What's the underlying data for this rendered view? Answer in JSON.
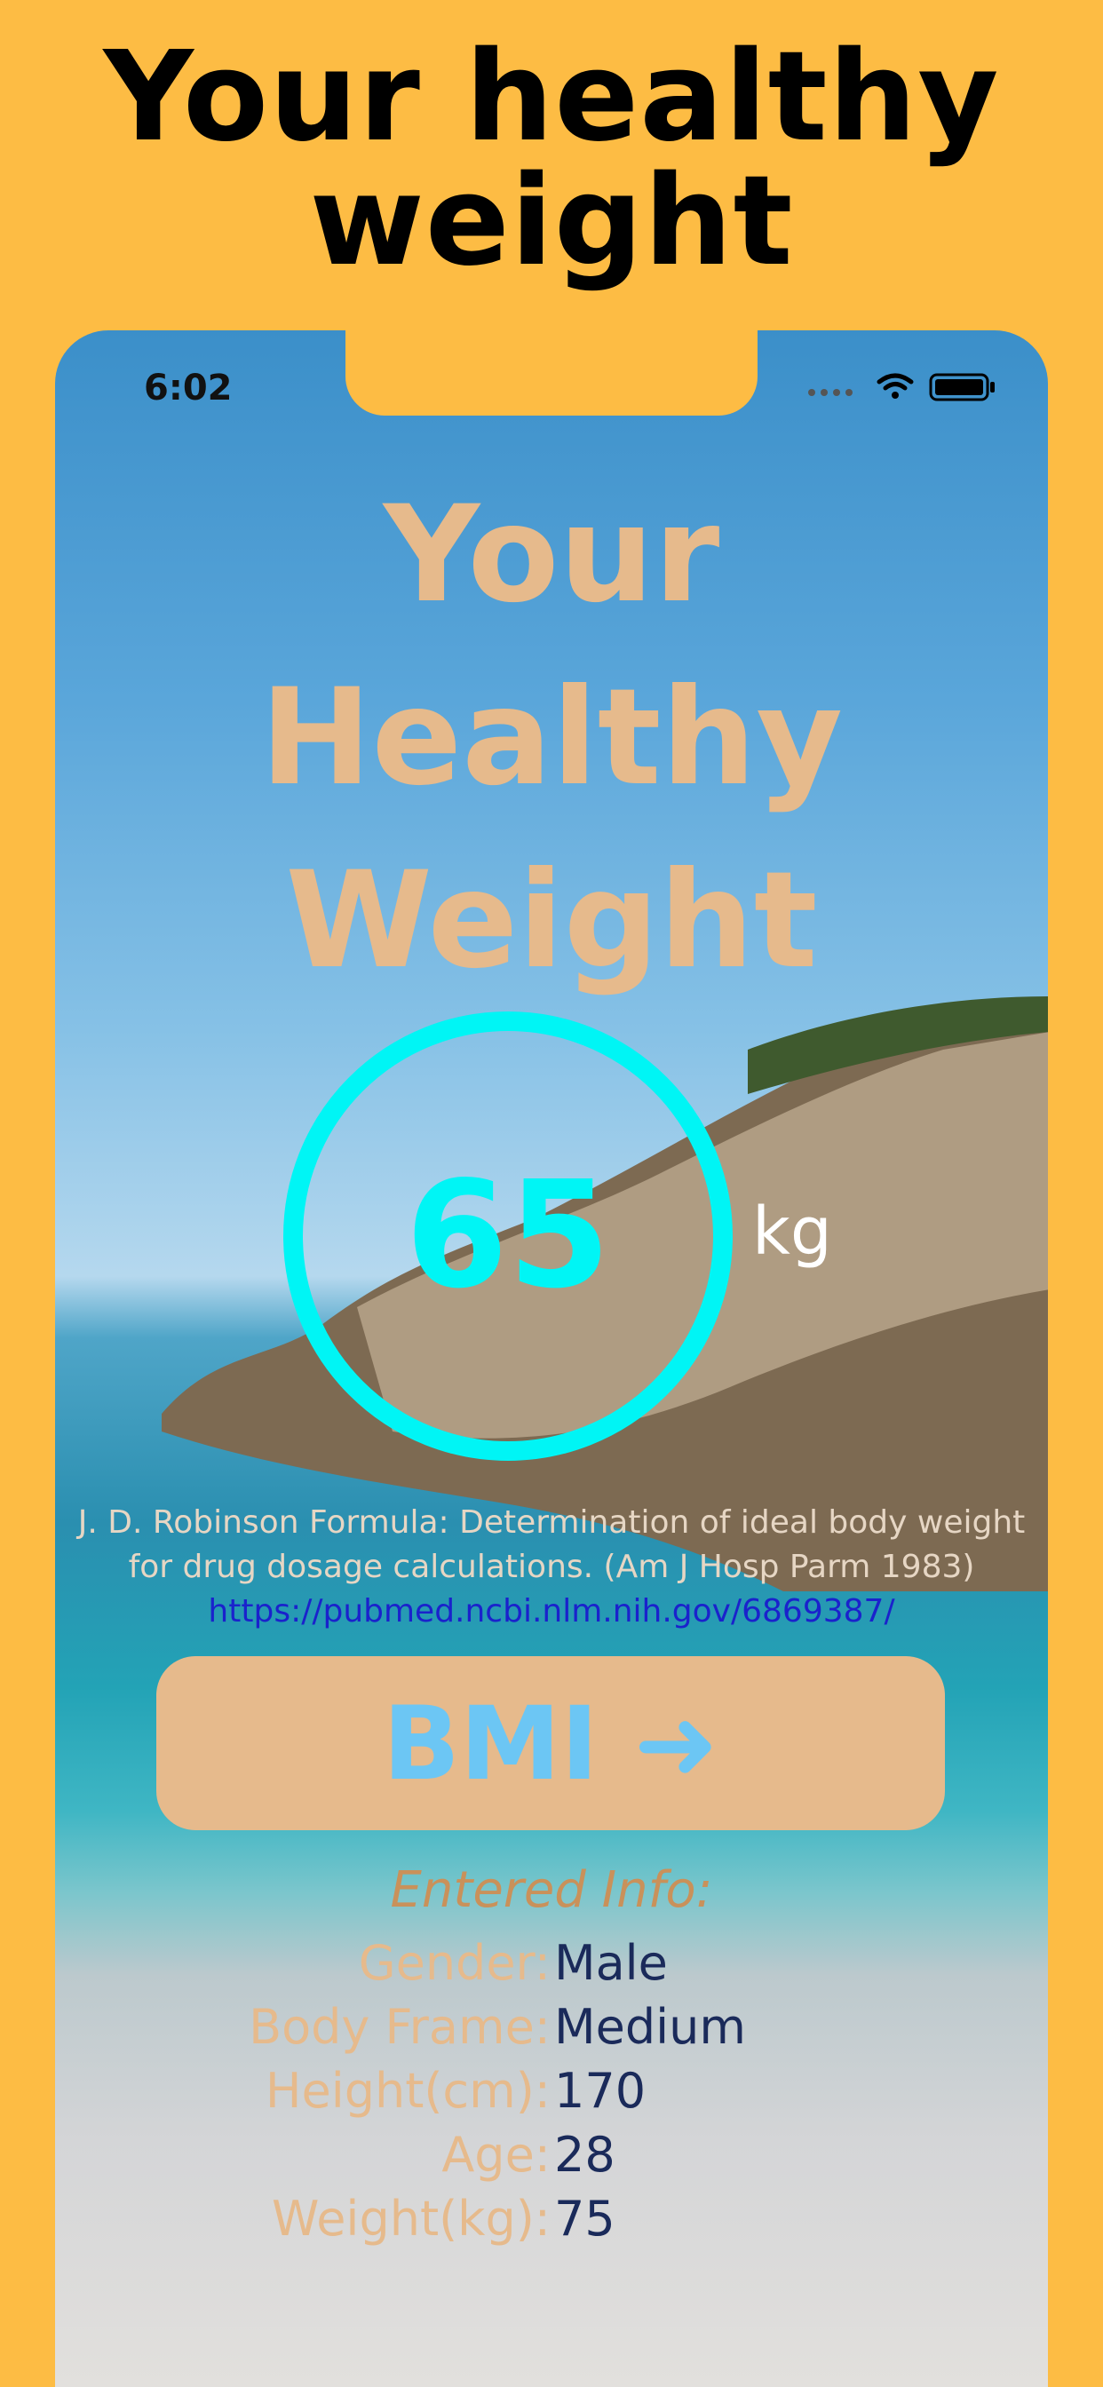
{
  "promo": {
    "title_line1": "Your healthy",
    "title_line2": "weight"
  },
  "status_bar": {
    "time": "6:02"
  },
  "app": {
    "title_line1": "Your",
    "title_line2": "Healthy",
    "title_line3": "Weight",
    "result": {
      "value": "65",
      "unit": "kg"
    },
    "formula_line1": "J. D. Robinson Formula: Determination of ideal body weight",
    "formula_line2": "for drug dosage calculations. (Am J Hosp Parm 1983)",
    "formula_link": "https://pubmed.ncbi.nlm.nih.gov/6869387/",
    "bmi_button_label": "BMI ➜",
    "entered_info": {
      "heading": "Entered Info:",
      "rows": [
        {
          "label": "Gender:",
          "value": "Male"
        },
        {
          "label": "Body Frame:",
          "value": "Medium"
        },
        {
          "label": "Height(cm):",
          "value": "170"
        },
        {
          "label": "Age:",
          "value": "28"
        },
        {
          "label": "Weight(kg):",
          "value": "75"
        }
      ]
    }
  },
  "colors": {
    "background": "#FDBC44",
    "title_text": "#E6BA8C",
    "ring": "#00F5F5",
    "button": "#E6BA8C",
    "button_text": "#6CC6F4",
    "link": "#1A22CC"
  }
}
